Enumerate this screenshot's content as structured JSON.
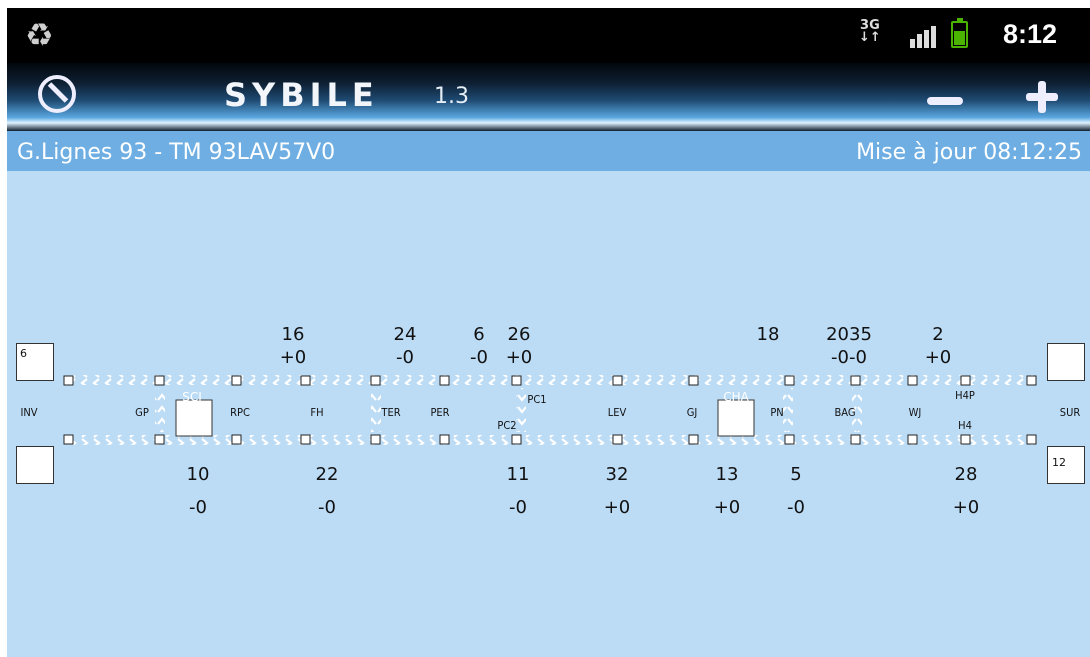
{
  "status_bar": {
    "network": "3G",
    "time": "8:12",
    "icons": [
      "recycle-icon",
      "3g-icon",
      "signal-icon",
      "battery-icon"
    ]
  },
  "action_bar": {
    "app_name": "SYBILE",
    "version": "1.3",
    "icons": [
      "app-logo-icon",
      "zoom-out-icon",
      "zoom-in-icon"
    ]
  },
  "header": {
    "title": "G.Lignes 93 - TM 93LAV57V0",
    "update": "Mise à jour 08:12:25"
  },
  "colors": {
    "status_bar": "#000000",
    "header": "#6eaee2",
    "background": "#bcdcf6",
    "track": "#ffffff"
  },
  "stations": [
    "INV",
    "GP",
    "RPC",
    "FH",
    "TER",
    "PER",
    "PC1",
    "PC2",
    "LEV",
    "GJ",
    "PN",
    "BAG",
    "WJ",
    "H4P",
    "H4",
    "SUR"
  ],
  "station_overlays": [
    "SCI",
    "CHA"
  ],
  "terminals": {
    "top_left": "6",
    "bottom_right": "12"
  },
  "top_counts": [
    {
      "count": "16",
      "delta": "+0"
    },
    {
      "count": "24",
      "delta": "-0"
    },
    {
      "count": "6",
      "delta": "-0"
    },
    {
      "count": "26",
      "delta": "+0"
    },
    {
      "count": "18",
      "delta": ""
    },
    {
      "count": "2035",
      "delta": "-0-0"
    },
    {
      "count": "2",
      "delta": "+0"
    }
  ],
  "bottom_counts": [
    {
      "count": "10",
      "delta": "-0"
    },
    {
      "count": "22",
      "delta": "-0"
    },
    {
      "count": "11",
      "delta": "-0"
    },
    {
      "count": "32",
      "delta": "+0"
    },
    {
      "count": "13",
      "delta": "+0"
    },
    {
      "count": "5",
      "delta": "-0"
    },
    {
      "count": "28",
      "delta": "+0"
    }
  ]
}
